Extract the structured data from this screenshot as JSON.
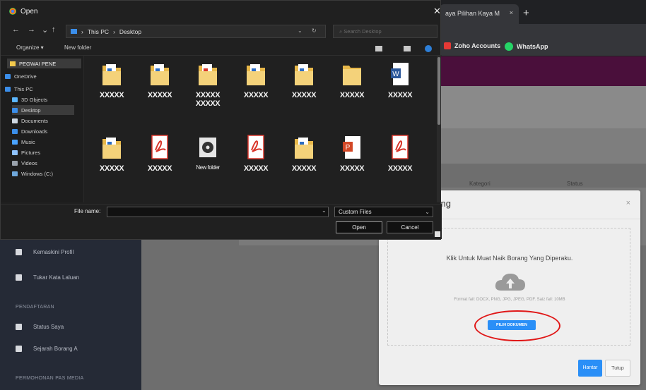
{
  "browser": {
    "tab_title": "aya Pilihan Kaya M",
    "tab_close": "×",
    "new_tab": "+",
    "bookmarks": [
      {
        "label": "Zoho Accounts",
        "color": "#e53935"
      },
      {
        "label": "WhatsApp",
        "color": "#25d366"
      }
    ]
  },
  "app": {
    "columns": [
      "Kategori",
      "Status"
    ],
    "sidebar": {
      "items": [
        {
          "label": "Kemaskini Profil"
        },
        {
          "label": "Tukar Kata Laluan"
        }
      ],
      "section_pendaftaran": "PENDAFTARAN",
      "items2": [
        {
          "label": "Status Saya"
        },
        {
          "label": "Sejarah Borang A"
        }
      ],
      "section_permohonan": "PERMOHONAN PAS MEDIA"
    }
  },
  "modal": {
    "title": "rang",
    "close": "×",
    "dropzone_title": "Klik Untuk Muat Naik Borang Yang Diperaku.",
    "dropzone_hint": "Format fail: DOCX, PNG, JPG, JPEG, PDF. Saiz fail: 10MB",
    "pick_button": "PILIH DOKUMEN",
    "submit": "Hantar",
    "close_button": "Tutup",
    "accent": "#2a8ff7",
    "highlight": "#e01818"
  },
  "dialog": {
    "title": "Open",
    "close": "✕",
    "nav": {
      "back": "←",
      "forward": "→",
      "recent": "⌄",
      "up": "↑"
    },
    "path": [
      "This PC",
      "Desktop"
    ],
    "path_sep": "›",
    "refresh": "↻",
    "search_placeholder": "Search Desktop",
    "organize": "Organize ▾",
    "new_folder": "New folder",
    "nav_pane": {
      "pinned": "PEGWAI PENE",
      "items": [
        {
          "label": "OneDrive"
        },
        {
          "label": "This PC"
        },
        {
          "label": "3D Objects"
        },
        {
          "label": "Desktop"
        },
        {
          "label": "Documents"
        },
        {
          "label": "Downloads"
        },
        {
          "label": "Music"
        },
        {
          "label": "Pictures"
        },
        {
          "label": "Videos"
        },
        {
          "label": "Windows (C:)"
        }
      ]
    },
    "files": [
      {
        "label": "XXXXX",
        "type": "doc-folder"
      },
      {
        "label": "XXXXX",
        "type": "doc-folder"
      },
      {
        "label": "XXXXX XXXXX",
        "type": "pdf-folder"
      },
      {
        "label": "XXXXX",
        "type": "doc-folder"
      },
      {
        "label": "XXXXX",
        "type": "doc-folder"
      },
      {
        "label": "XXXXX",
        "type": "folder"
      },
      {
        "label": "XXXXX",
        "type": "word"
      },
      {
        "label": "XXXXX",
        "type": "doc-folder"
      },
      {
        "label": "XXXXX",
        "type": "pdf"
      },
      {
        "label": "New folder",
        "type": "disc"
      },
      {
        "label": "XXXXX",
        "type": "pdf"
      },
      {
        "label": "XXXXX",
        "type": "doc-folder"
      },
      {
        "label": "XXXXX",
        "type": "ppt"
      },
      {
        "label": "XXXXX",
        "type": "pdf"
      }
    ],
    "file_name_label": "File name:",
    "file_name_value": "",
    "filter": "Custom Files",
    "open": "Open",
    "cancel": "Cancel"
  }
}
